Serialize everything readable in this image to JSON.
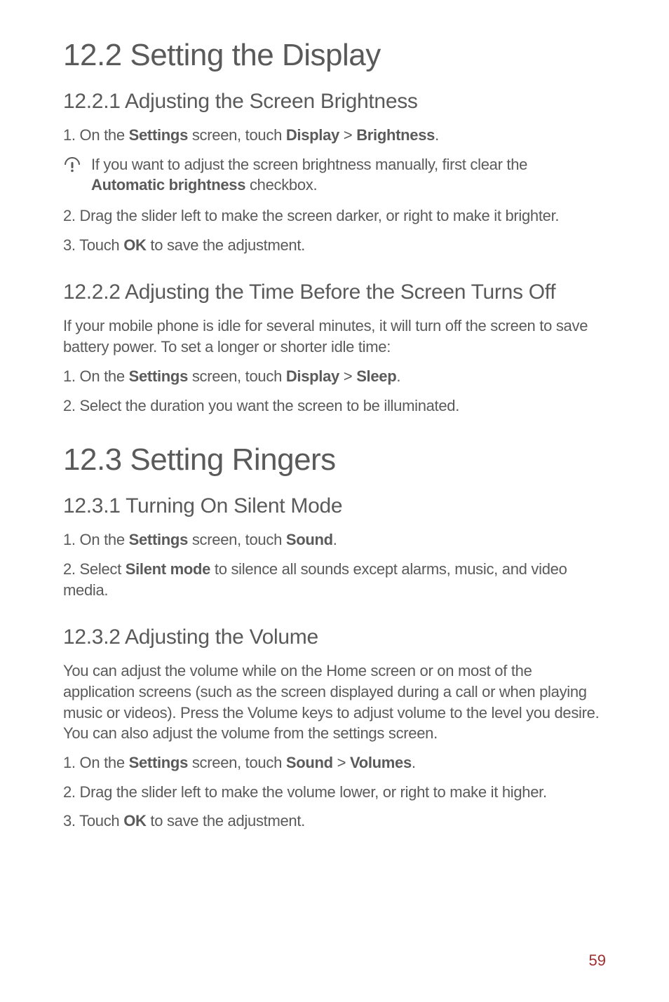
{
  "sections": {
    "s12_2": {
      "title": "12.2  Setting the Display",
      "s12_2_1": {
        "heading": "12.2.1  Adjusting the Screen Brightness",
        "step1_pre": "1. On the ",
        "step1_b1": "Settings",
        "step1_mid1": " screen, touch ",
        "step1_b2": "Display",
        "step1_mid2": " > ",
        "step1_b3": "Brightness",
        "step1_end": ".",
        "note_pre": "If you want to adjust the screen brightness manually, first clear the ",
        "note_b1": "Automatic brightness",
        "note_end": " checkbox.",
        "step2": "2. Drag the slider left to make the screen darker, or right to make it brighter.",
        "step3_pre": "3. Touch ",
        "step3_b1": "OK",
        "step3_end": " to save the adjustment."
      },
      "s12_2_2": {
        "heading": "12.2.2  Adjusting the Time Before the Screen Turns Off",
        "intro": "If your mobile phone is idle for several minutes, it will turn off the screen to save battery power. To set a longer or shorter idle time:",
        "step1_pre": "1. On the ",
        "step1_b1": "Settings",
        "step1_mid1": " screen, touch ",
        "step1_b2": "Display",
        "step1_mid2": " > ",
        "step1_b3": "Sleep",
        "step1_end": ".",
        "step2": "2. Select the duration you want the screen to be illuminated."
      }
    },
    "s12_3": {
      "title": "12.3  Setting Ringers",
      "s12_3_1": {
        "heading": "12.3.1  Turning On Silent Mode",
        "step1_pre": "1. On the ",
        "step1_b1": "Settings",
        "step1_mid1": " screen, touch ",
        "step1_b2": "Sound",
        "step1_end": ".",
        "step2_pre": "2. Select ",
        "step2_b1": "Silent mode",
        "step2_end": " to silence all sounds except alarms, music, and video media."
      },
      "s12_3_2": {
        "heading": "12.3.2  Adjusting the Volume",
        "intro": "You can adjust the volume while on the Home screen or on most of the application screens (such as the screen displayed during a call or when playing music or videos). Press the Volume keys to adjust volume to the level you desire. You can also adjust the volume from the settings screen.",
        "step1_pre": "1. On the ",
        "step1_b1": "Settings",
        "step1_mid1": " screen, touch ",
        "step1_b2": "Sound",
        "step1_mid2": " > ",
        "step1_b3": "Volumes",
        "step1_end": ".",
        "step2": "2. Drag the slider left to make the volume lower, or right to make it higher.",
        "step3_pre": "3. Touch ",
        "step3_b1": "OK",
        "step3_end": " to save the adjustment."
      }
    }
  },
  "page_number": "59"
}
